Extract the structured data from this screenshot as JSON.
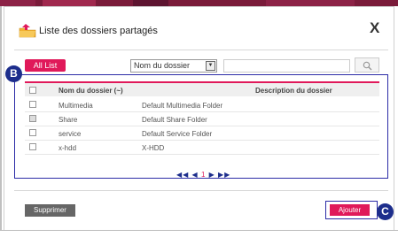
{
  "dialog": {
    "title": "Liste des dossiers partagés",
    "close_label": "X"
  },
  "toolbar": {
    "all_list_label": "All List",
    "filter_selected": "Nom du dossier",
    "search_value": ""
  },
  "badges": {
    "b": "B",
    "c": "C"
  },
  "table": {
    "headers": [
      "Nom du dossier (~)",
      "Description du dossier"
    ],
    "rows": [
      {
        "name": "Multimedia",
        "description": "Default Multimedia Folder"
      },
      {
        "name": "Share",
        "description": "Default Share Folder"
      },
      {
        "name": "service",
        "description": "Default Service Folder"
      },
      {
        "name": "x-hdd",
        "description": "X-HDD"
      }
    ]
  },
  "pagination": {
    "first": "◀◀",
    "prev": "◀",
    "page": "1",
    "next": "▶",
    "last": "▶▶"
  },
  "footer": {
    "delete_label": "Supprimer",
    "add_label": "Ajouter"
  },
  "colors": {
    "accent": "#e0195a",
    "badge": "#1d2e8c",
    "highlight_border": "#2b2ba6"
  }
}
